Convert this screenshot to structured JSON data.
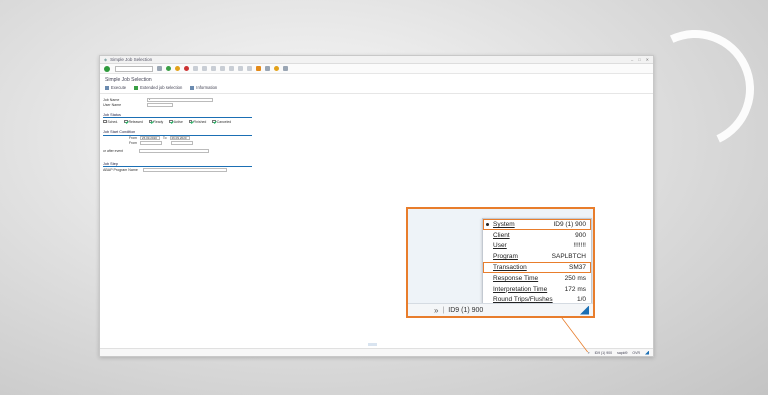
{
  "window": {
    "title": "Simple Job Selection",
    "page_title": "Simple Job Selection"
  },
  "app_toolbar": [
    {
      "label": "Execute"
    },
    {
      "label": "Extended job selection"
    },
    {
      "label": "Information"
    }
  ],
  "form": {
    "job_name_label": "Job Name",
    "job_name_value": "*",
    "user_name_label": "User Name",
    "job_status_title": "Job Status",
    "statuses": [
      {
        "label": "Sched.",
        "checked": false
      },
      {
        "label": "Released",
        "checked": true
      },
      {
        "label": "Ready",
        "checked": true
      },
      {
        "label": "Active",
        "checked": true
      },
      {
        "label": "Finished",
        "checked": true
      },
      {
        "label": "Canceled",
        "checked": true
      }
    ],
    "job_start_title": "Job Start Condition",
    "from_label": "From",
    "to_label": "To",
    "date_from": "26.09.2020",
    "date_to": "26.09.2020",
    "or_after_event_label": "or after event",
    "job_step_title": "Job Step",
    "abap_program_label": "ABAP Program Name"
  },
  "status_bar": {
    "system": "ID9 (1) 900",
    "server": "sapid9",
    "mode": "OVR"
  },
  "zoom": {
    "status_bar_text": "ID9 (1) 900",
    "popup_items": [
      {
        "label": "System",
        "value": "ID9 (1) 900",
        "selected": true,
        "highlighted": true
      },
      {
        "label": "Client",
        "value": "900",
        "selected": false,
        "highlighted": false
      },
      {
        "label": "User",
        "value": "!!!!!!!",
        "selected": false,
        "highlighted": false
      },
      {
        "label": "Program",
        "value": "SAPLBTCH",
        "selected": false,
        "highlighted": false
      },
      {
        "label": "Transaction",
        "value": "SM37",
        "selected": false,
        "highlighted": true
      },
      {
        "label": "Response Time",
        "value": "250 ms",
        "selected": false,
        "highlighted": false
      },
      {
        "label": "Interpretation Time",
        "value": "172 ms",
        "selected": false,
        "highlighted": false
      },
      {
        "label": "Round Trips/Flushes",
        "value": "1/0",
        "selected": false,
        "highlighted": false
      }
    ]
  },
  "colors": {
    "highlight": "#e87d2c",
    "sap_blue": "#1b6fb4",
    "ok_green": "#2e9a3c"
  }
}
